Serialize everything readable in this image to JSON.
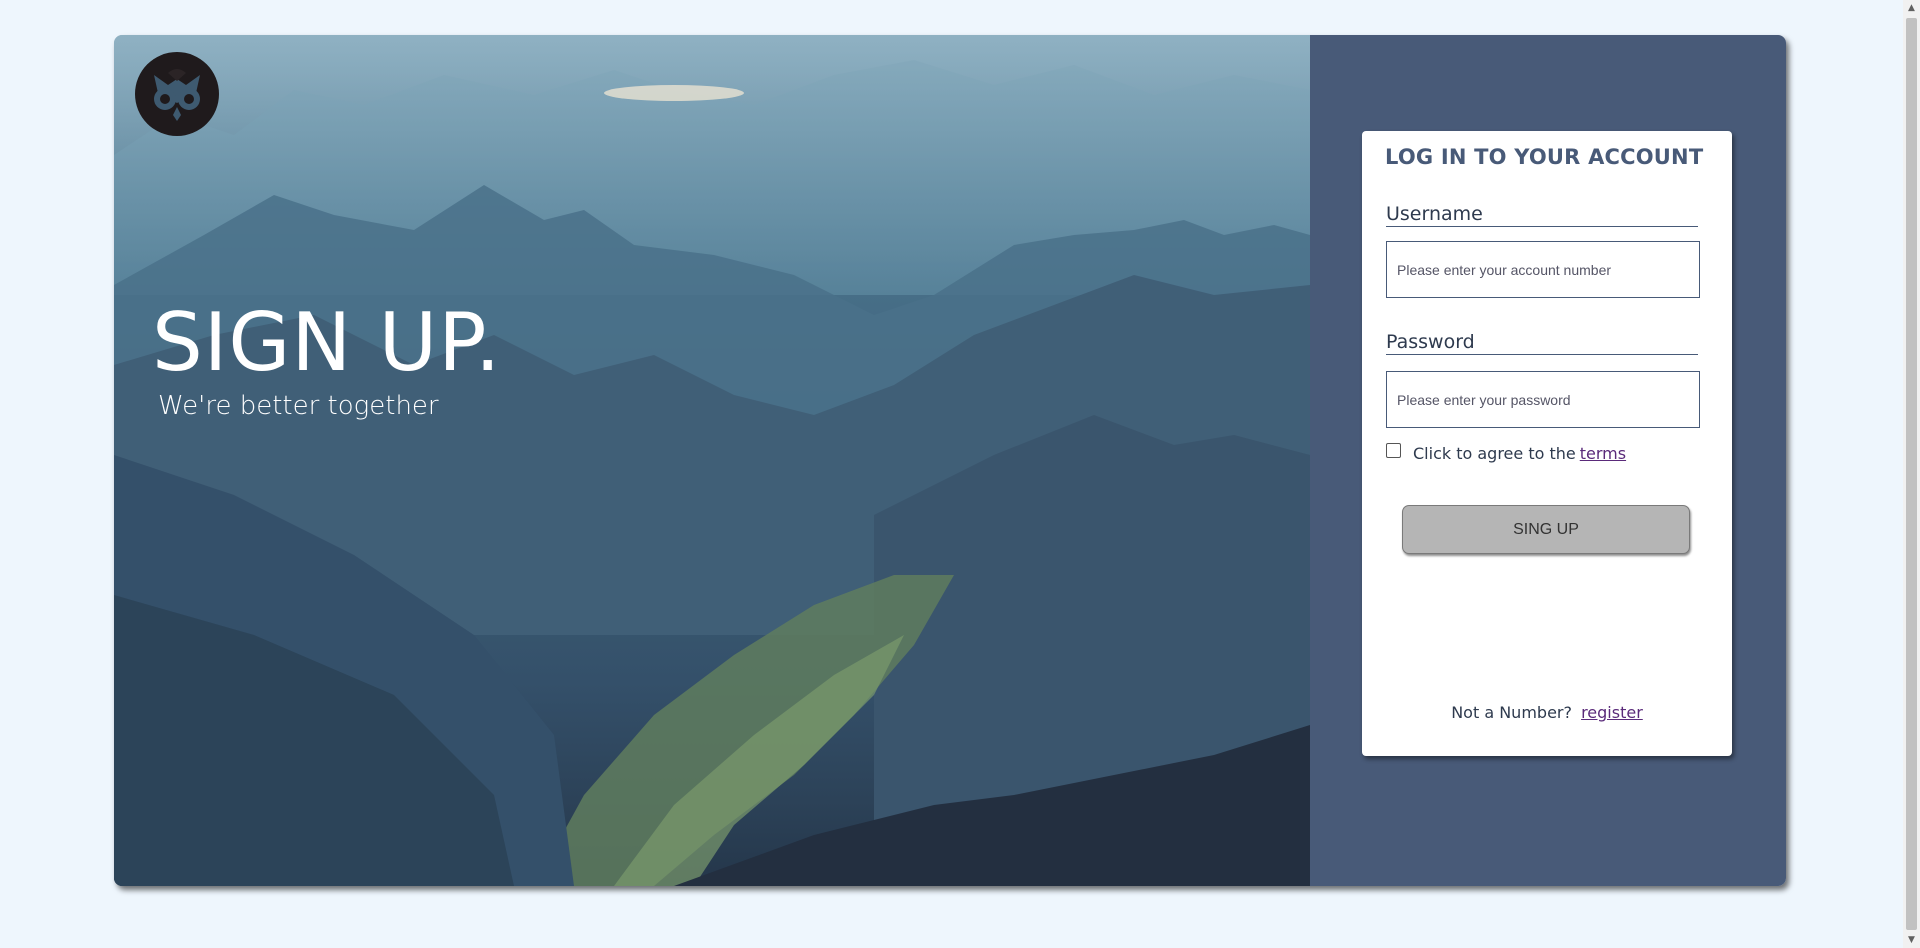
{
  "hero": {
    "title": "SIGN UP.",
    "subtitle": "We're better together"
  },
  "login": {
    "heading": "LOG IN TO YOUR ACCOUNT",
    "username_label": "Username",
    "username_placeholder": "Please enter your account number",
    "password_label": "Password",
    "password_placeholder": "Please enter your password",
    "terms_text": "Click to agree to the",
    "terms_link": "terms",
    "terms_checked": false,
    "submit_label": "SING UP",
    "register_text": "Not a Number?",
    "register_link": "register"
  },
  "icons": {
    "logo": "owl-logo-icon",
    "scroll_up": "arrow-up-icon",
    "scroll_down": "arrow-down-icon"
  },
  "colors": {
    "page_background": "#eef6fd",
    "side_panel": "#485a78",
    "button": "#b5b5b5",
    "link": "#5a2a7a"
  }
}
